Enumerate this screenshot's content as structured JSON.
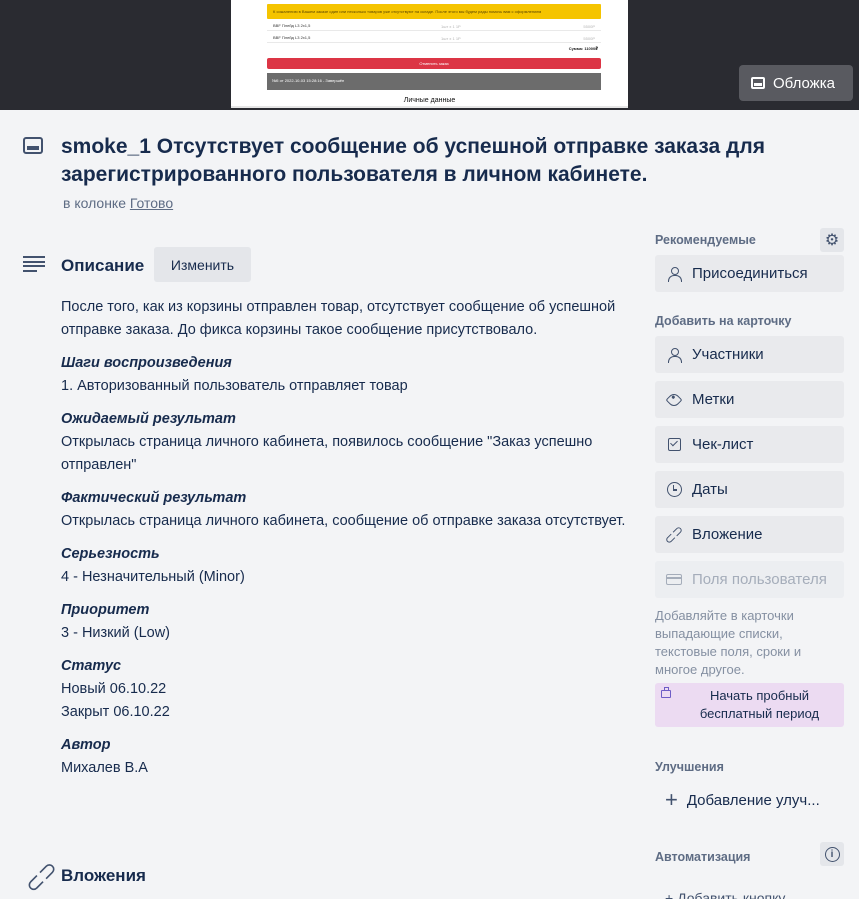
{
  "cover": {
    "alert_text": "К сожалению в Вашем заказе один или несколько товаров уже отсутствуют на складе. После этого мы будем рады помочь вам с оформлением",
    "items": [
      {
        "name": "BBF Плейд L3 2x1,5",
        "qty": "1шт x 1 1P",
        "price": "5500P"
      },
      {
        "name": "BBF Плейд L3 2x1,5",
        "qty": "1шт x 1 1P",
        "price": "5500P"
      }
    ],
    "sum_text": "Сумма: 11000₽",
    "cancel_text": "Отменить заказ",
    "order_text": "№5 от 2022-10-03 15:28:16 - Завершён",
    "personal_text": "Личные данные",
    "button_label": "Обложка"
  },
  "card": {
    "title": "smoke_1 Отсутствует сообщение об успешной отправке заказа для зарегистрированного пользователя в личном кабинете.",
    "in_list_prefix": "в колонке",
    "list_name": "Готово"
  },
  "description": {
    "heading": "Описание",
    "edit_label": "Изменить",
    "intro": "После того, как из корзины отправлен товар, отсутствует сообщение об успешной отправке заказа. До фикса корзины такое сообщение присутствовало.",
    "steps_label": "Шаги воспроизведения",
    "steps": "1. Авторизованный пользователь отправляет товар",
    "expected_label": "Ожидаемый результат",
    "expected": "Открылась страница личного кабинета, появилось сообщение \"Заказ успешно отправлен\"",
    "actual_label": "Фактический результат",
    "actual": "Открылась страница личного кабинета, сообщение об отправке заказа отсутствует.",
    "severity_label": "Серьезность",
    "severity": "4 - Незначительный (Minor)",
    "priority_label": "Приоритет",
    "priority": "3 - Низкий (Low)",
    "status_label": "Статус",
    "status_new": "Новый 06.10.22",
    "status_closed": "Закрыт 06.10.22",
    "author_label": "Автор",
    "author": "Михалев В.А"
  },
  "attachments": {
    "heading": "Вложения"
  },
  "sidebar": {
    "suggested_heading": "Рекомендуемые",
    "join_label": "Присоединиться",
    "add_heading": "Добавить на карточку",
    "members_label": "Участники",
    "labels_label": "Метки",
    "checklist_label": "Чек-лист",
    "dates_label": "Даты",
    "attachment_label": "Вложение",
    "custom_fields_label": "Поля пользователя",
    "custom_fields_note": "Добавляйте в карточки выпадающие списки, текстовые поля, сроки и многое другое.",
    "trial_label": "Начать пробный бесплатный период",
    "powerups_heading": "Улучшения",
    "add_powerup_label": "Добавление улуч...",
    "automation_heading": "Автоматизация",
    "automation_cut_label": "Добавить кнопку"
  }
}
